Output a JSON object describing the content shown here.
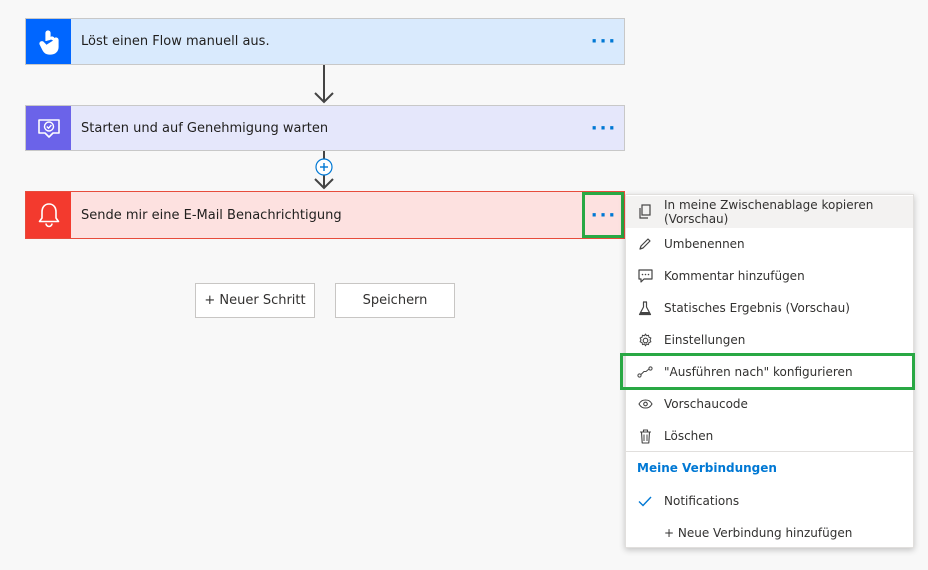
{
  "flow": {
    "step1": {
      "title": "Löst einen Flow manuell aus.",
      "more": "···"
    },
    "step2": {
      "title": "Starten und auf Genehmigung warten",
      "more": "···"
    },
    "step3": {
      "title": "Sende mir eine E-Mail Benachrichtigung",
      "more": "···"
    }
  },
  "actions": {
    "new_step": "+ Neuer Schritt",
    "save": "Speichern"
  },
  "context_menu": {
    "items": [
      {
        "label": "In meine Zwischenablage kopieren (Vorschau)",
        "icon": "copy-icon"
      },
      {
        "label": "Umbenennen",
        "icon": "pencil-icon"
      },
      {
        "label": "Kommentar hinzufügen",
        "icon": "comment-icon"
      },
      {
        "label": "Statisches Ergebnis (Vorschau)",
        "icon": "flask-icon"
      },
      {
        "label": "Einstellungen",
        "icon": "gear-icon"
      },
      {
        "label": "\"Ausführen nach\" konfigurieren",
        "icon": "run-after-icon"
      },
      {
        "label": "Vorschaucode",
        "icon": "eye-icon"
      },
      {
        "label": "Löschen",
        "icon": "trash-icon"
      }
    ],
    "section_title": "Meine Verbindungen",
    "connection": "Notifications",
    "add_connection": "+ Neue Verbindung hinzufügen"
  },
  "colors": {
    "step1_icon": "#0066ff",
    "step2_icon": "#6b63e9",
    "step3_icon": "#f33a2e",
    "highlight": "#29a844",
    "accent": "#0078d4"
  }
}
